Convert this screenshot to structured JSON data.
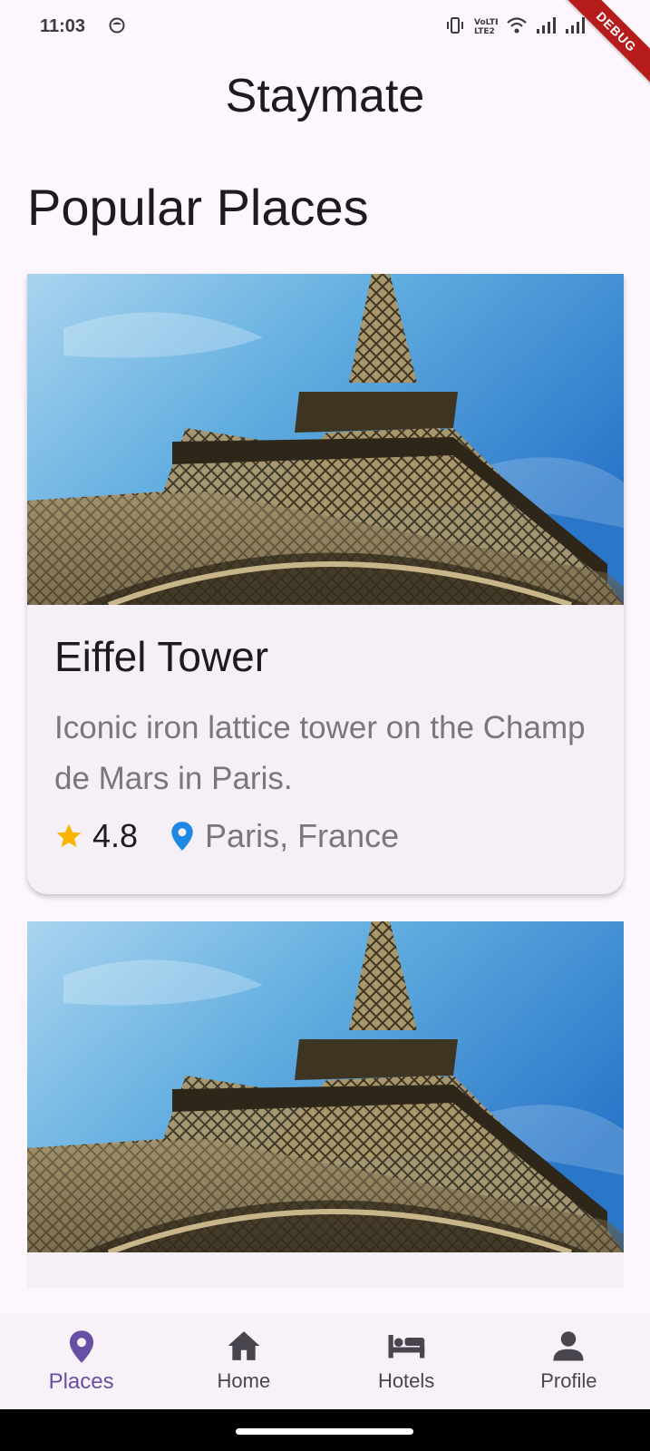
{
  "status_bar": {
    "time": "11:03",
    "debug_label": "DEBUG",
    "network_label": "VoLTE2"
  },
  "app": {
    "title": "Staymate"
  },
  "section": {
    "title": "Popular Places"
  },
  "places": [
    {
      "name": "Eiffel Tower",
      "description": "Iconic iron lattice tower on the Champ de Mars in Paris.",
      "rating": "4.8",
      "location": "Paris, France"
    }
  ],
  "bottom_nav": {
    "items": [
      {
        "label": "Places",
        "icon": "location-pin-icon",
        "active": true
      },
      {
        "label": "Home",
        "icon": "home-icon",
        "active": false
      },
      {
        "label": "Hotels",
        "icon": "bed-icon",
        "active": false
      },
      {
        "label": "Profile",
        "icon": "person-icon",
        "active": false
      }
    ]
  },
  "colors": {
    "accent": "#6750a4",
    "star": "#f9b400",
    "pin": "#1e88e5",
    "background": "#fdf7fd"
  }
}
